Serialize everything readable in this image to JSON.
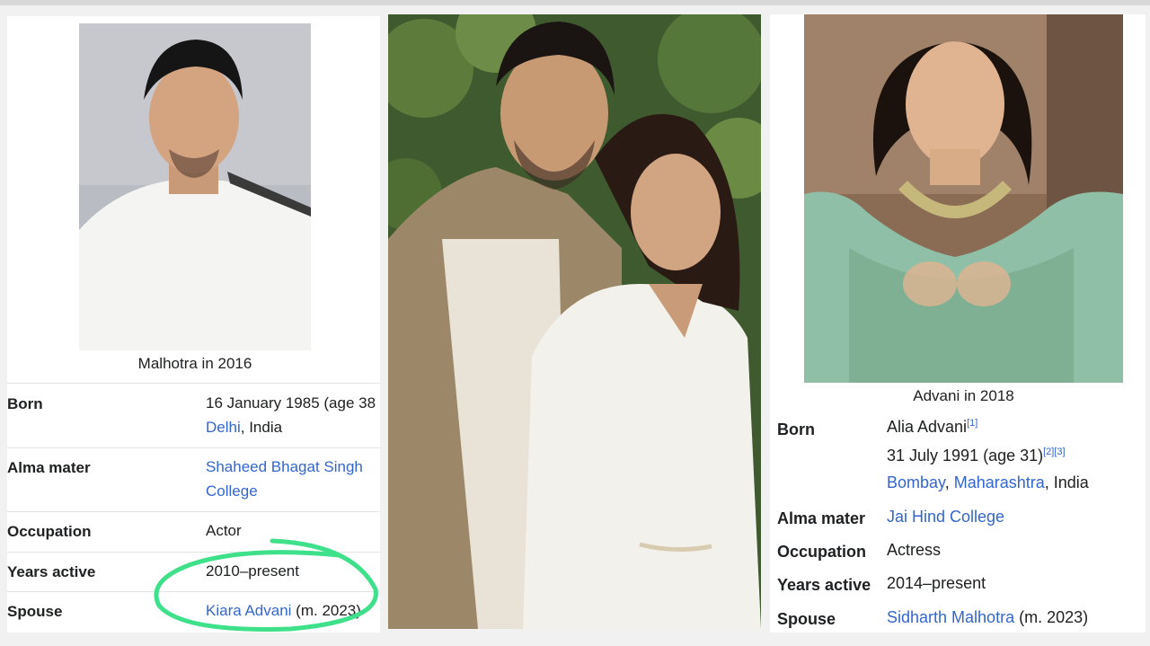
{
  "left": {
    "caption": "Malhotra in 2016",
    "rows": [
      {
        "label": "Born",
        "line1": "16 January 1985 (age 38",
        "place_link": "Delhi",
        "place_rest": ", India"
      },
      {
        "label": "Alma mater",
        "link1": "Shaheed Bhagat Singh",
        "link2": "College"
      },
      {
        "label": "Occupation",
        "value": "Actor"
      },
      {
        "label": "Years active",
        "value": "2010–present"
      },
      {
        "label": "Spouse",
        "link": "Kiara Advani",
        "rest": " (m. 2023)"
      }
    ]
  },
  "right": {
    "caption": "Advani in 2018",
    "rows": [
      {
        "label": "Born",
        "name": "Alia Advani",
        "name_ref": "[1]",
        "dob": "31 July 1991 (age 31)",
        "dob_ref": "[2][3]",
        "city": "Bombay",
        "sep": ", ",
        "state": "Maharashtra",
        "country": ", India"
      },
      {
        "label": "Alma mater",
        "link": "Jai Hind College"
      },
      {
        "label": "Occupation",
        "value": "Actress"
      },
      {
        "label": "Years active",
        "value": "2014–present"
      },
      {
        "label": "Spouse",
        "link": "Sidharth Malhotra",
        "rest": " (m. 2023)"
      }
    ]
  },
  "colors": {
    "link": "#3366cc",
    "highlight": "#3ee08a",
    "text": "#202122"
  },
  "icons": [
    "photo-malhotra",
    "photo-couple",
    "photo-advani",
    "highlight-circle"
  ]
}
